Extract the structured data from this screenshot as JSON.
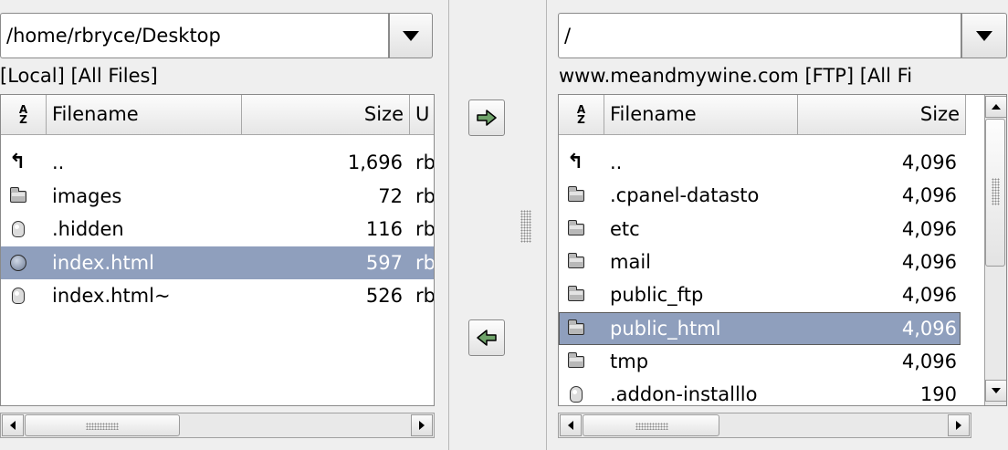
{
  "local": {
    "path": "/home/rbryce/Desktop",
    "label": "[Local]  [All Files]",
    "columns": {
      "filename": "Filename",
      "size": "Size",
      "owner": "U"
    },
    "files": [
      {
        "name": "..",
        "size": "1,696",
        "owner": "rb",
        "icon": "up-arrow-icon"
      },
      {
        "name": "images",
        "size": "72",
        "owner": "rb",
        "icon": "folder-icon"
      },
      {
        "name": ".hidden",
        "size": "116",
        "owner": "rb",
        "icon": "file-icon"
      },
      {
        "name": "index.html",
        "size": "597",
        "owner": "rb",
        "icon": "html-globe-icon",
        "selected": true
      },
      {
        "name": "index.html~",
        "size": "526",
        "owner": "rb",
        "icon": "file-icon"
      }
    ]
  },
  "remote": {
    "path": "/",
    "label": "www.meandmywine.com  [FTP]  [All Fi",
    "columns": {
      "filename": "Filename",
      "size": "Size"
    },
    "files": [
      {
        "name": "..",
        "size": "4,096",
        "icon": "up-arrow-icon"
      },
      {
        "name": ".cpanel-datasto",
        "size": "4,096",
        "icon": "folder-icon"
      },
      {
        "name": "etc",
        "size": "4,096",
        "icon": "folder-icon"
      },
      {
        "name": "mail",
        "size": "4,096",
        "icon": "folder-icon"
      },
      {
        "name": "public_ftp",
        "size": "4,096",
        "icon": "folder-icon"
      },
      {
        "name": "public_html",
        "size": "4,096",
        "icon": "folder-icon",
        "selected": true
      },
      {
        "name": "tmp",
        "size": "4,096",
        "icon": "folder-icon"
      },
      {
        "name": ".addon-installlo",
        "size": "190",
        "icon": "file-icon"
      }
    ]
  },
  "transfer": {
    "upload_icon": "arrow-right-icon",
    "download_icon": "arrow-left-icon"
  },
  "colors": {
    "selection": "#8f9fbd",
    "arrow_fill": "#6fa36a"
  }
}
